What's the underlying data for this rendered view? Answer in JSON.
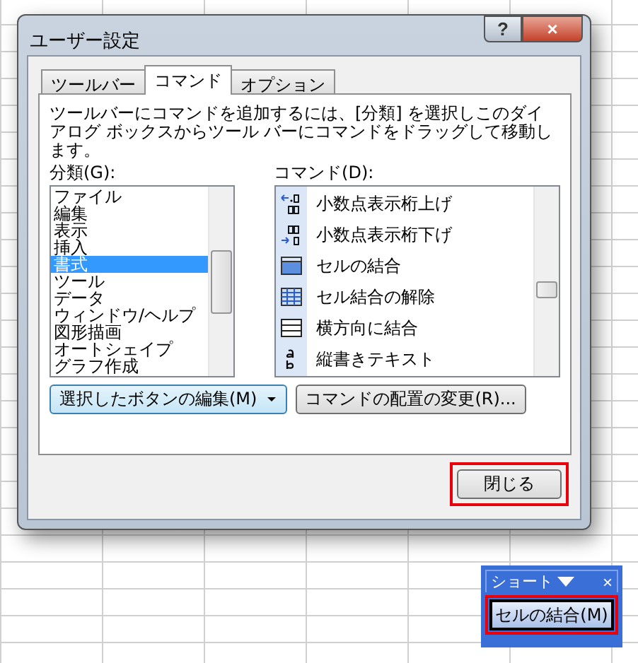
{
  "window": {
    "title": "ユーザー設定",
    "help": "?",
    "close": "×"
  },
  "tabs": [
    {
      "label": "ツールバー",
      "selected": false
    },
    {
      "label": "コマンド",
      "selected": true
    },
    {
      "label": "オプション",
      "selected": false
    }
  ],
  "description": "ツールバーにコマンドを追加するには、[分類] を選択しこのダイアログ ボックスからツール バーにコマンドをドラッグして移動します。",
  "categories": {
    "label": "分類(G):",
    "items": [
      {
        "label": "ファイル",
        "selected": false
      },
      {
        "label": "編集",
        "selected": false
      },
      {
        "label": "表示",
        "selected": false
      },
      {
        "label": "挿入",
        "selected": false
      },
      {
        "label": "書式",
        "selected": true
      },
      {
        "label": "ツール",
        "selected": false
      },
      {
        "label": "データ",
        "selected": false
      },
      {
        "label": "ウィンドウ/ヘルプ",
        "selected": false
      },
      {
        "label": "図形描画",
        "selected": false
      },
      {
        "label": "オートシェイプ",
        "selected": false
      },
      {
        "label": "グラフ作成",
        "selected": false
      }
    ]
  },
  "commands": {
    "label": "コマンド(D):",
    "items": [
      {
        "label": "小数点表示桁上げ",
        "kind": "decimal-up"
      },
      {
        "label": "小数点表示桁下げ",
        "kind": "decimal-down"
      },
      {
        "label": "セルの結合",
        "kind": "merge"
      },
      {
        "label": "セル結合の解除",
        "kind": "unmerge"
      },
      {
        "label": "横方向に結合",
        "kind": "across"
      },
      {
        "label": "縦書きテキスト",
        "kind": "vertical"
      }
    ]
  },
  "buttons": {
    "modify": "選択したボタンの編集(M)",
    "rearrange": "コマンドの配置の変更(R)...",
    "close": "閉じる"
  },
  "toolbar": {
    "title": "ショート",
    "close": "×",
    "button": "セルの結合(M)"
  }
}
